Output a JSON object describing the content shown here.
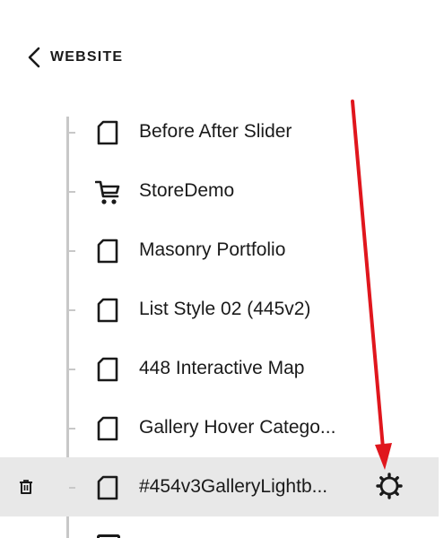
{
  "nav": {
    "back_label": "WEBSITE"
  },
  "pages": [
    {
      "label": "Before After Slider",
      "icon": "page-icon",
      "selected": false
    },
    {
      "label": "StoreDemo",
      "icon": "cart-icon",
      "selected": false
    },
    {
      "label": "Masonry Portfolio",
      "icon": "page-icon",
      "selected": false
    },
    {
      "label": "List Style 02 (445v2)",
      "icon": "page-icon",
      "selected": false
    },
    {
      "label": "448 Interactive Map",
      "icon": "page-icon",
      "selected": false
    },
    {
      "label": "Gallery Hover Catego...",
      "icon": "page-icon",
      "selected": false
    },
    {
      "label": "#454v3GalleryLightb...",
      "icon": "page-icon",
      "selected": true
    }
  ],
  "selected_actions": {
    "delete_icon": "trash-icon",
    "settings_icon": "gear-icon"
  },
  "annotation": {
    "color": "#e0161d",
    "shape": "red-arrow-pointing-to-settings"
  }
}
